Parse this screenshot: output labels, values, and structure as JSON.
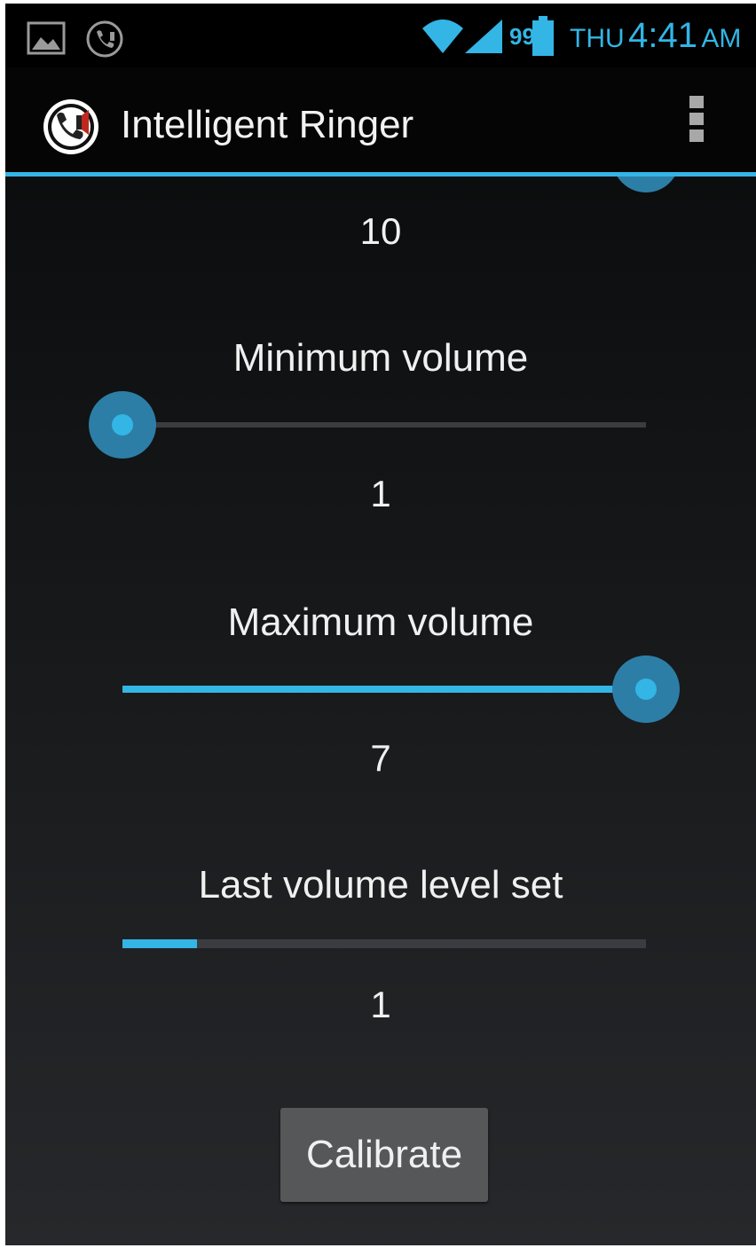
{
  "status_bar": {
    "battery_level": "99",
    "day": "THU",
    "time": "4:41",
    "ampm": "AM",
    "icons": [
      "gallery-icon",
      "intelligent-ringer-notification-icon",
      "wifi-icon",
      "signal-icon",
      "battery-icon"
    ]
  },
  "action_bar": {
    "title": "Intelligent Ringer",
    "app_icon": "intelligent-ringer-icon",
    "overflow_icon": "overflow-menu-icon"
  },
  "settings": {
    "previous_value": "10",
    "minimum_volume": {
      "label": "Minimum volume",
      "value": "1",
      "level": 0
    },
    "maximum_volume": {
      "label": "Maximum volume",
      "value": "7",
      "level": 1
    },
    "last_volume": {
      "label": "Last volume level set",
      "value": "1",
      "level": 0.143
    },
    "calibrate_label": "Calibrate"
  },
  "colors": {
    "accent": "#33b5e5",
    "thumb_halo": "#2c7ea6",
    "background": "#000000",
    "button": "#555759"
  }
}
